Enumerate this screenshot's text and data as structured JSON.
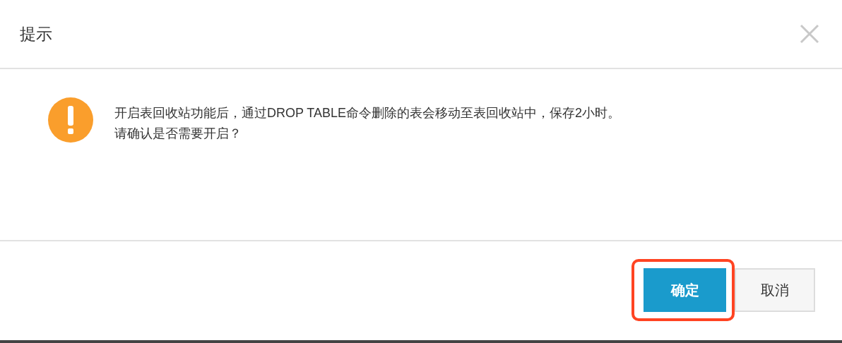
{
  "dialog": {
    "title": "提示",
    "message": [
      "开启表回收站功能后，通过DROP TABLE命令删除的表会移动至表回收站中，保存2小时。",
      "请确认是否需要开启？"
    ],
    "buttons": [
      {
        "label": "确定",
        "kind": "primary",
        "highlighted": true
      },
      {
        "label": "取消",
        "kind": "secondary",
        "highlighted": false
      }
    ]
  }
}
